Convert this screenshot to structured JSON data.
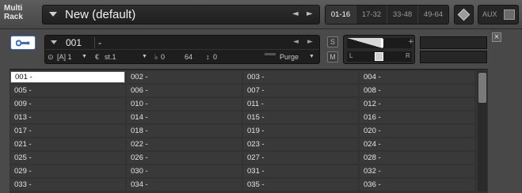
{
  "app": {
    "title_line1": "Multi",
    "title_line2": "Rack"
  },
  "preset": {
    "name": "New (default)",
    "prev": "◄",
    "next": "►"
  },
  "banks": [
    {
      "label": "01-16",
      "active": true
    },
    {
      "label": "17-32",
      "active": false
    },
    {
      "label": "33-48",
      "active": false
    },
    {
      "label": "49-64",
      "active": false
    }
  ],
  "aux": {
    "label": "AUX"
  },
  "instrument": {
    "number": "001",
    "name": "-",
    "output": "[A] 1",
    "midi_channel": "st.1",
    "tune": "0",
    "voices": "64",
    "polyphony": "0",
    "purge": "Purge",
    "solo": "S",
    "mute": "M",
    "pan_left": "L",
    "pan_right": "R",
    "volume_plus": "+",
    "close": "×",
    "volume_level": 0.55,
    "pan_position": 0.5
  },
  "slots": [
    "001 -",
    "002 -",
    "003 -",
    "004 -",
    "005 -",
    "006 -",
    "007 -",
    "008 -",
    "009 -",
    "010 -",
    "011 -",
    "012 -",
    "013 -",
    "014 -",
    "015 -",
    "016 -",
    "017 -",
    "018 -",
    "019 -",
    "020 -",
    "021 -",
    "022 -",
    "023 -",
    "024 -",
    "025 -",
    "026 -",
    "027 -",
    "028 -",
    "029 -",
    "030 -",
    "031 -",
    "032 -",
    "033 -",
    "034 -",
    "035 -",
    "036 -"
  ],
  "selected_slot": 0,
  "colors": {
    "accent": "#3a6fbf",
    "panel": "#1e1e1e",
    "background": "#4a4a4a"
  }
}
